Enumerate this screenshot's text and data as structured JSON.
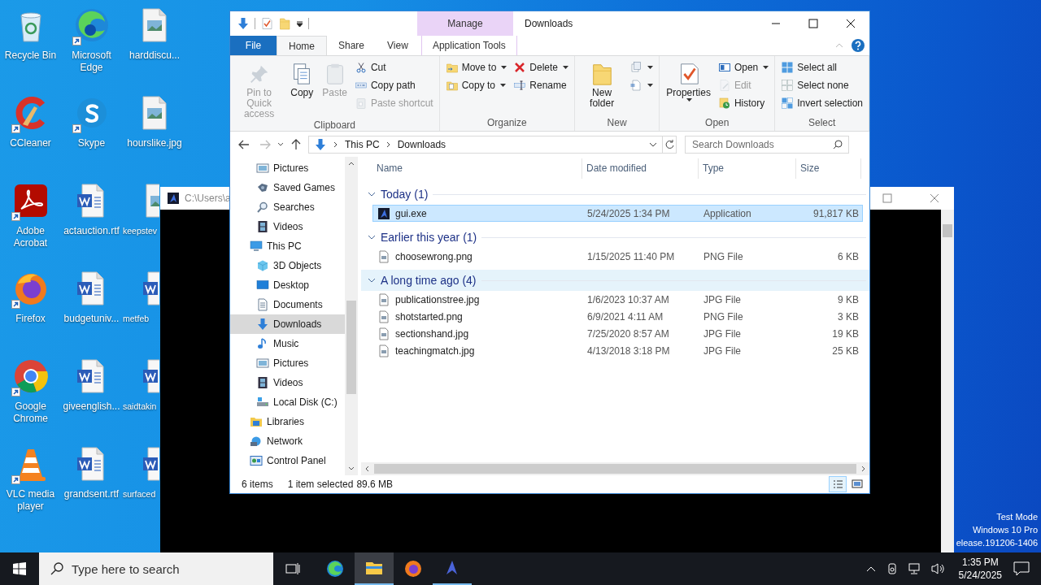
{
  "desktop_columns": [
    {
      "icons": [
        {
          "label": "Recycle Bin",
          "kind": "recycle",
          "shortcut": false
        },
        {
          "label": "CCleaner",
          "kind": "ccleaner",
          "shortcut": true
        },
        {
          "label": "Adobe Acrobat",
          "kind": "acrobat",
          "shortcut": true
        },
        {
          "label": "Firefox",
          "kind": "firefox",
          "shortcut": true
        },
        {
          "label": "Google Chrome",
          "kind": "chrome",
          "shortcut": true
        },
        {
          "label": "VLC media player",
          "kind": "vlc",
          "shortcut": true
        }
      ]
    },
    {
      "icons": [
        {
          "label": "Microsoft Edge",
          "kind": "edge",
          "shortcut": true
        },
        {
          "label": "Skype",
          "kind": "skype",
          "shortcut": true
        },
        {
          "label": "actauction.rtf",
          "kind": "word",
          "shortcut": false
        },
        {
          "label": "budgetuniv...",
          "kind": "word",
          "shortcut": false
        },
        {
          "label": "giveenglish...",
          "kind": "word",
          "shortcut": false
        },
        {
          "label": "grandsent.rtf",
          "kind": "word",
          "shortcut": false
        }
      ]
    },
    {
      "icons": [
        {
          "label": "harddiscu...",
          "kind": "image",
          "shortcut": false
        },
        {
          "label": "hourslike.jpg",
          "kind": "image",
          "shortcut": false
        },
        {
          "label": "keepstev",
          "kind": "image",
          "shortcut": false
        },
        {
          "label": "metfeb",
          "kind": "word",
          "shortcut": false
        },
        {
          "label": "saidtakin",
          "kind": "word",
          "shortcut": false
        },
        {
          "label": "surfaced",
          "kind": "word",
          "shortcut": false
        }
      ]
    }
  ],
  "console_window": {
    "title": "C:\\Users\\a"
  },
  "explorer": {
    "title": "Downloads",
    "contextual_tab": {
      "group": "Manage",
      "label": "Application Tools",
      "selected": false
    },
    "tabs": [
      {
        "label": "File",
        "kind": "file",
        "selected": false
      },
      {
        "label": "Home",
        "kind": "tab",
        "selected": true
      },
      {
        "label": "Share",
        "kind": "tab",
        "selected": false
      },
      {
        "label": "View",
        "kind": "tab",
        "selected": false
      }
    ],
    "ribbon_groups": [
      {
        "label": "Clipboard",
        "columns": [
          {
            "commands": [
              {
                "label": "Pin to Quick access",
                "kind": "pin",
                "disabled": true,
                "dropdown": false
              }
            ]
          },
          {
            "commands": [
              {
                "label": "Copy",
                "kind": "copy",
                "disabled": false,
                "dropdown": false
              }
            ]
          },
          {
            "commands": [
              {
                "label": "Paste",
                "kind": "paste",
                "disabled": true,
                "dropdown": false
              }
            ]
          },
          {
            "commands": [
              {
                "label": "Cut",
                "kind": "cut",
                "disabled": false,
                "dropdown": false
              },
              {
                "label": "Copy path",
                "kind": "copypath",
                "disabled": false,
                "dropdown": false
              },
              {
                "label": "Paste shortcut",
                "kind": "pasteshortcut",
                "disabled": true,
                "dropdown": false
              }
            ]
          }
        ]
      },
      {
        "label": "Organize",
        "columns": [
          {
            "commands": [
              {
                "label": "Move to",
                "kind": "moveto",
                "disabled": false,
                "dropdown": true
              },
              {
                "label": "Copy to",
                "kind": "copyto",
                "disabled": false,
                "dropdown": true
              }
            ]
          },
          {
            "commands": [
              {
                "label": "Delete",
                "kind": "delete",
                "disabled": false,
                "dropdown": true
              },
              {
                "label": "Rename",
                "kind": "rename",
                "disabled": false,
                "dropdown": false
              }
            ]
          }
        ]
      },
      {
        "label": "New",
        "columns": [
          {
            "commands": [
              {
                "label": "New folder",
                "kind": "newfolder",
                "disabled": false,
                "dropdown": false
              }
            ]
          },
          {
            "commands": [
              {
                "kind": "newitem",
                "disabled": false,
                "dropdown": true
              },
              {
                "kind": "easyaccess",
                "disabled": false,
                "dropdown": true
              }
            ]
          }
        ]
      },
      {
        "label": "Open",
        "columns": [
          {
            "commands": [
              {
                "label": "Properties",
                "kind": "properties",
                "disabled": false,
                "dropdown": true
              }
            ]
          },
          {
            "commands": [
              {
                "label": "Open",
                "kind": "open",
                "disabled": false,
                "dropdown": true
              },
              {
                "label": "Edit",
                "kind": "edit",
                "disabled": true,
                "dropdown": false
              },
              {
                "label": "History",
                "kind": "history",
                "disabled": false,
                "dropdown": false
              }
            ]
          }
        ]
      },
      {
        "label": "Select",
        "columns": [
          {
            "commands": [
              {
                "label": "Select all",
                "kind": "selectall",
                "disabled": false,
                "dropdown": false
              },
              {
                "label": "Select none",
                "kind": "selectnone",
                "disabled": false,
                "dropdown": false
              },
              {
                "label": "Invert selection",
                "kind": "invert",
                "disabled": false,
                "dropdown": false
              }
            ]
          }
        ]
      }
    ],
    "address": {
      "path": [
        "This PC",
        "Downloads"
      ]
    },
    "search": {
      "placeholder": "Search Downloads"
    },
    "nav_pane": [
      {
        "children": [
          {
            "label": "Pictures",
            "kind": "pictures",
            "selected": false
          },
          {
            "label": "Saved Games",
            "kind": "games",
            "selected": false
          },
          {
            "label": "Searches",
            "kind": "search",
            "selected": false
          },
          {
            "label": "Videos",
            "kind": "videos",
            "selected": false
          }
        ]
      },
      {
        "label": "This PC",
        "kind": "pc",
        "selected": false,
        "children": [
          {
            "label": "3D Objects",
            "kind": "objects",
            "selected": false
          },
          {
            "label": "Desktop",
            "kind": "desktop",
            "selected": false
          },
          {
            "label": "Documents",
            "kind": "documents",
            "selected": false
          },
          {
            "label": "Downloads",
            "kind": "downloads",
            "selected": true
          },
          {
            "label": "Music",
            "kind": "music",
            "selected": false
          },
          {
            "label": "Pictures",
            "kind": "pictures",
            "selected": false
          },
          {
            "label": "Videos",
            "kind": "videos",
            "selected": false
          },
          {
            "label": "Local Disk (C:)",
            "kind": "disk",
            "selected": false
          }
        ]
      },
      {
        "label": "Libraries",
        "kind": "libraries",
        "selected": false
      },
      {
        "label": "Network",
        "kind": "network",
        "selected": false
      },
      {
        "label": "Control Panel",
        "kind": "controlpanel",
        "selected": false
      }
    ],
    "columns": [
      "Name",
      "Date modified",
      "Type",
      "Size"
    ],
    "groups": [
      {
        "label": "Today (1)",
        "hovered": false,
        "rows": [
          {
            "name": "gui.exe",
            "kind": "app",
            "date": "5/24/2025 1:34 PM",
            "type": "Application",
            "size": "91,817 KB",
            "selected": true
          }
        ]
      },
      {
        "label": "Earlier this year (1)",
        "hovered": false,
        "rows": [
          {
            "name": "choosewrong.png",
            "kind": "image",
            "date": "1/15/2025 11:40 PM",
            "type": "PNG File",
            "size": "6 KB",
            "selected": false
          }
        ]
      },
      {
        "label": "A long time ago (4)",
        "hovered": true,
        "rows": [
          {
            "name": "publicationstree.jpg",
            "kind": "image",
            "date": "1/6/2023 10:37 AM",
            "type": "JPG File",
            "size": "9 KB",
            "selected": false
          },
          {
            "name": "shotstarted.png",
            "kind": "image",
            "date": "6/9/2021 4:11 AM",
            "type": "PNG File",
            "size": "3 KB",
            "selected": false
          },
          {
            "name": "sectionshand.jpg",
            "kind": "image",
            "date": "7/25/2020 8:57 AM",
            "type": "JPG File",
            "size": "19 KB",
            "selected": false
          },
          {
            "name": "teachingmatch.jpg",
            "kind": "image",
            "date": "4/13/2018 3:18 PM",
            "type": "JPG File",
            "size": "25 KB",
            "selected": false
          }
        ]
      }
    ],
    "status": {
      "count": "6 items",
      "selection": "1 item selected",
      "size": "89.6 MB"
    }
  },
  "desktop_notice": [
    "Test Mode",
    "Windows 10 Pro",
    "elease.191206-1406"
  ],
  "taskbar": {
    "search_placeholder": "Type here to search",
    "apps": [
      {
        "kind": "edge",
        "active": false,
        "running": false
      },
      {
        "kind": "explorer",
        "active": true,
        "running": true
      },
      {
        "kind": "firefox",
        "active": false,
        "running": false
      },
      {
        "kind": "app",
        "active": false,
        "running": true
      }
    ],
    "time": "1:35 PM",
    "date": "5/24/2025"
  }
}
